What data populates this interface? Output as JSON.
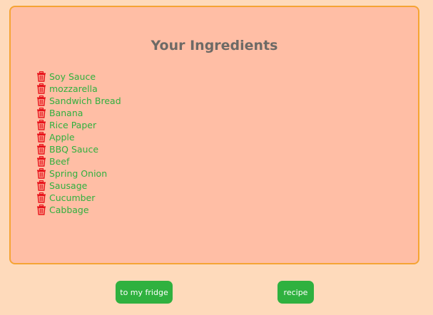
{
  "panel": {
    "title": "Your Ingredients",
    "ingredients": [
      "Soy Sauce",
      "mozzarella",
      "Sandwich Bread",
      "Banana",
      "Rice Paper",
      "Apple",
      "BBQ Sauce",
      "Beef",
      "Spring Onion",
      "Sausage",
      "Cucumber",
      "Cabbage"
    ]
  },
  "buttons": {
    "fridge_label": "to my fridge",
    "recipe_label": "recipe"
  },
  "colors": {
    "page_background": "#fedabb",
    "panel_background": "#ffbea5",
    "panel_border": "#f5a434",
    "ingredient_text": "#30b03e",
    "trash_icon": "#e8131b",
    "button_background": "#2fb13f"
  },
  "icons": {
    "delete": "trash-icon"
  }
}
